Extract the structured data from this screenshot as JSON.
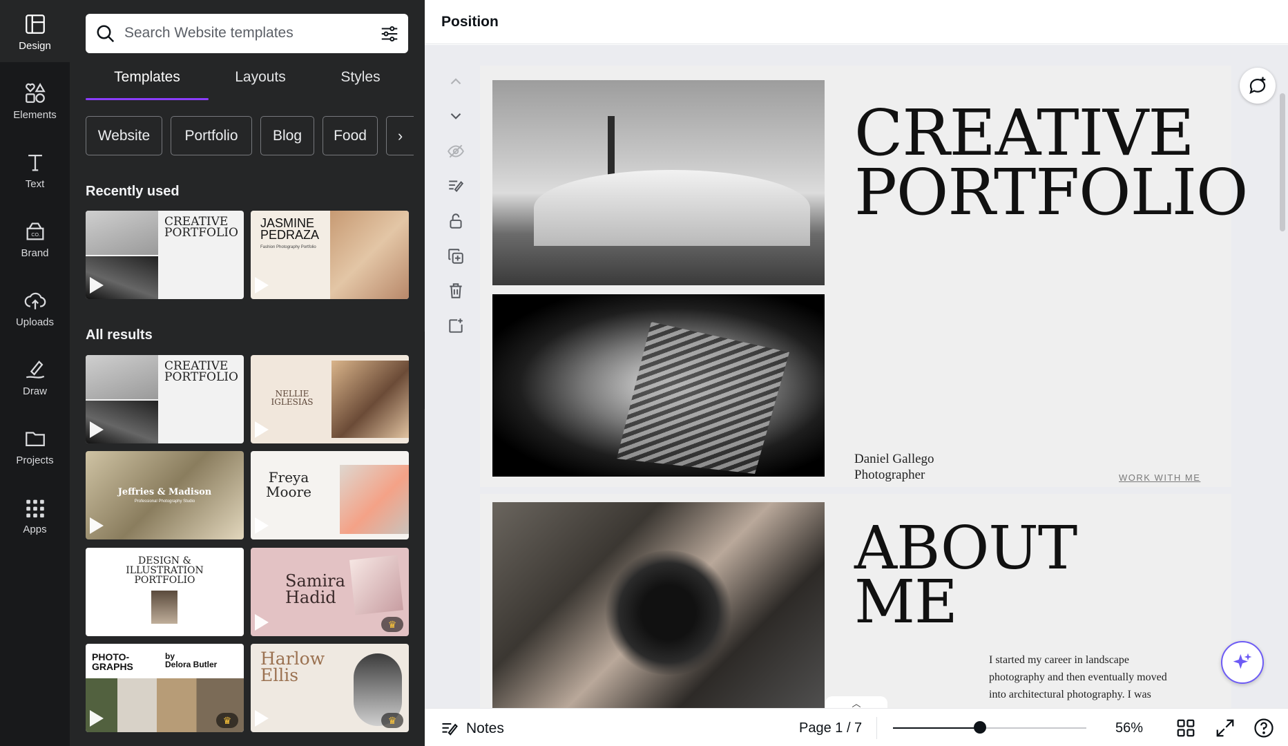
{
  "rail": {
    "items": [
      {
        "label": "Design",
        "icon": "layout-icon"
      },
      {
        "label": "Elements",
        "icon": "shapes-icon"
      },
      {
        "label": "Text",
        "icon": "text-icon"
      },
      {
        "label": "Brand",
        "icon": "brand-icon"
      },
      {
        "label": "Uploads",
        "icon": "cloud-upload-icon"
      },
      {
        "label": "Draw",
        "icon": "pen-icon"
      },
      {
        "label": "Projects",
        "icon": "folder-icon"
      },
      {
        "label": "Apps",
        "icon": "apps-grid-icon"
      }
    ]
  },
  "panel": {
    "search_placeholder": "Search Website templates",
    "tabs": [
      "Templates",
      "Layouts",
      "Styles"
    ],
    "chips": [
      "Website",
      "Portfolio",
      "Blog",
      "Food"
    ],
    "recently_used_title": "Recently used",
    "all_results_title": "All results",
    "recent": [
      {
        "title": "CREATIVE\nPORTFOLIO"
      },
      {
        "title": "JASMINE\nPEDRAZA",
        "sub": "Fashion Photography Portfolio"
      }
    ],
    "results": [
      {
        "title": "CREATIVE\nPORTFOLIO"
      },
      {
        "title": "NELLIE\nIGLESIAS"
      },
      {
        "title": "Jeffries & Madison",
        "sub": "Professional Photography Studio"
      },
      {
        "title": "Freya\nMoore"
      },
      {
        "title": "DESIGN &\nILLUSTRATION\nPORTFOLIO"
      },
      {
        "title": "Samira\nHadid",
        "pro": true
      },
      {
        "title": "PHOTO-\nGRAPHS",
        "by": "by\nDelora Butler",
        "pro": true
      },
      {
        "title": "Harlow\nEllis",
        "pro": true
      }
    ]
  },
  "topbar": {
    "position_label": "Position"
  },
  "canvas": {
    "hero_title": "CREATIVE\nPORTFOLIO",
    "person_name": "Daniel Gallego\nPhotographer",
    "work_link": "WORK WITH ME",
    "about_title": "ABOUT\nME",
    "about_text": "I started my career in landscape photography and then eventually moved into architectural photography. I was"
  },
  "bottombar": {
    "notes_label": "Notes",
    "page_indicator": "Page 1 / 7",
    "zoom_value": "56%",
    "zoom_fraction": 0.45
  },
  "colors": {
    "accent": "#8b3dff",
    "rail_bg": "#18191b",
    "panel_bg": "#252627",
    "canvas_bg": "#ebecf0"
  }
}
